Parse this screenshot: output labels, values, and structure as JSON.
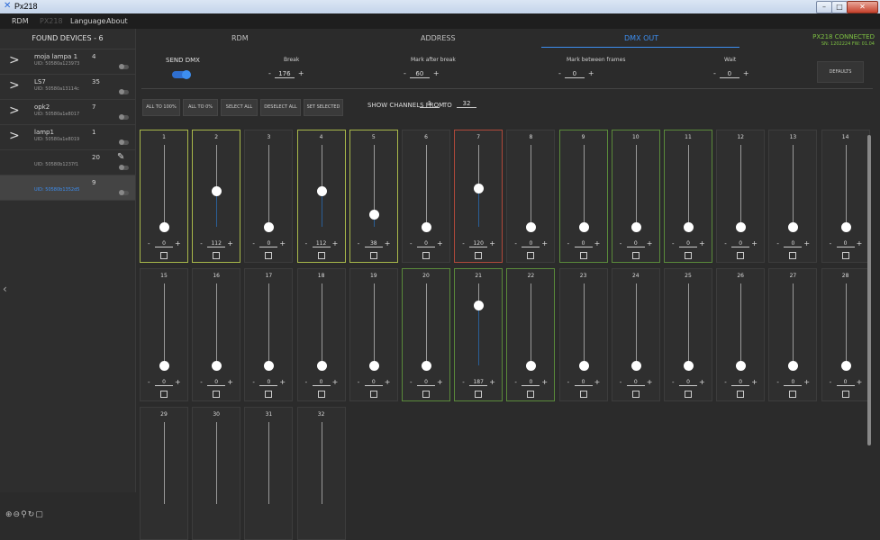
{
  "window": {
    "title": "Px218",
    "min": "–",
    "max": "□",
    "close": "✕"
  },
  "menu": [
    {
      "label": "RDM",
      "dim": false
    },
    {
      "label": "PX218",
      "dim": true
    },
    {
      "label": "Language",
      "dim": false
    },
    {
      "label": "About",
      "dim": false
    }
  ],
  "sidebar": {
    "header": "FOUND DEVICES - 6",
    "devices": [
      {
        "name": "moja lampa 1",
        "uid": "UID: 50580a123973",
        "address": "4",
        "expandable": true,
        "selected": false
      },
      {
        "name": "LS7",
        "uid": "UID: 50580a13114c",
        "address": "35",
        "expandable": true,
        "selected": false
      },
      {
        "name": "opk2",
        "uid": "UID: 50580a1e8017",
        "address": "7",
        "expandable": true,
        "selected": false
      },
      {
        "name": "lamp1",
        "uid": "UID: 50580a1e8019",
        "address": "1",
        "expandable": true,
        "selected": false
      },
      {
        "name": "",
        "uid": "UID: 50580b1237f1",
        "address": "20",
        "expandable": false,
        "selected": false
      },
      {
        "name": "",
        "uid": "UID: 50580b1352d5",
        "address": "9",
        "expandable": false,
        "selected": true
      }
    ]
  },
  "tabs": [
    {
      "label": "RDM",
      "active": false
    },
    {
      "label": "ADDRESS",
      "active": false
    },
    {
      "label": "DMX OUT",
      "active": true
    }
  ],
  "status": {
    "connected": "PX218 CONNECTED",
    "info": "SN: 1202224 FW: 01.04"
  },
  "send_dmx": {
    "label": "SEND DMX",
    "on": true
  },
  "params": [
    {
      "label": "Break",
      "value": "176"
    },
    {
      "label": "Mark after break",
      "value": "60"
    },
    {
      "label": "Mark between frames",
      "value": "0"
    },
    {
      "label": "Wait",
      "value": "0"
    }
  ],
  "defaults_label": "DEFAULTS",
  "actions": [
    "ALL TO 100%",
    "ALL TO 0%",
    "SELECT ALL",
    "DESELECT ALL",
    "SET SELECTED"
  ],
  "range": {
    "label": "SHOW CHANNELS FROM",
    "from": "1",
    "to_label": "TO",
    "to": "32"
  },
  "colors": {
    "accent": "#3d8ef0",
    "connected": "#7dc142"
  },
  "channels": [
    {
      "n": "1",
      "v": "0",
      "hl": "y"
    },
    {
      "n": "2",
      "v": "112",
      "hl": "y"
    },
    {
      "n": "3",
      "v": "0",
      "hl": ""
    },
    {
      "n": "4",
      "v": "112",
      "hl": "y"
    },
    {
      "n": "5",
      "v": "38",
      "hl": "y"
    },
    {
      "n": "6",
      "v": "0",
      "hl": ""
    },
    {
      "n": "7",
      "v": "120",
      "hl": "r"
    },
    {
      "n": "8",
      "v": "0",
      "hl": ""
    },
    {
      "n": "9",
      "v": "0",
      "hl": "g"
    },
    {
      "n": "10",
      "v": "0",
      "hl": "g"
    },
    {
      "n": "11",
      "v": "0",
      "hl": "g"
    },
    {
      "n": "12",
      "v": "0",
      "hl": ""
    },
    {
      "n": "13",
      "v": "0",
      "hl": ""
    },
    {
      "n": "14",
      "v": "0",
      "hl": ""
    },
    {
      "n": "15",
      "v": "0",
      "hl": ""
    },
    {
      "n": "16",
      "v": "0",
      "hl": ""
    },
    {
      "n": "17",
      "v": "0",
      "hl": ""
    },
    {
      "n": "18",
      "v": "0",
      "hl": ""
    },
    {
      "n": "19",
      "v": "0",
      "hl": ""
    },
    {
      "n": "20",
      "v": "0",
      "hl": "g"
    },
    {
      "n": "21",
      "v": "187",
      "hl": "g"
    },
    {
      "n": "22",
      "v": "0",
      "hl": "g"
    },
    {
      "n": "23",
      "v": "0",
      "hl": ""
    },
    {
      "n": "24",
      "v": "0",
      "hl": ""
    },
    {
      "n": "25",
      "v": "0",
      "hl": ""
    },
    {
      "n": "26",
      "v": "0",
      "hl": ""
    },
    {
      "n": "27",
      "v": "0",
      "hl": ""
    },
    {
      "n": "28",
      "v": "0",
      "hl": ""
    },
    {
      "n": "29",
      "v": "",
      "hl": ""
    },
    {
      "n": "30",
      "v": "",
      "hl": ""
    },
    {
      "n": "31",
      "v": "",
      "hl": ""
    },
    {
      "n": "32",
      "v": "",
      "hl": ""
    }
  ],
  "toolbar_icons": [
    "zoom-in-icon",
    "zoom-out-icon",
    "search-icon",
    "refresh-icon",
    "window-icon"
  ]
}
